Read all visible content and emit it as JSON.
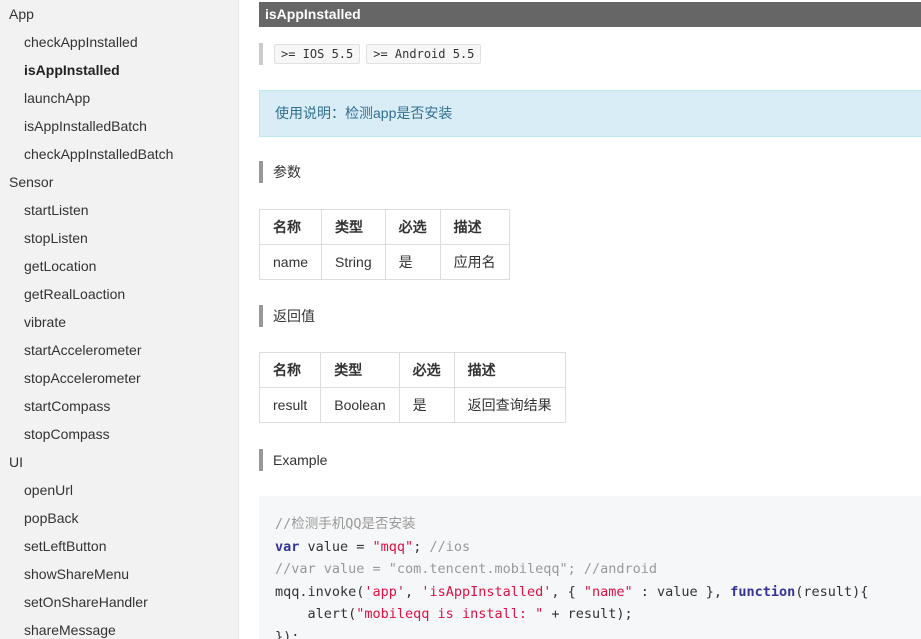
{
  "sidebar": {
    "rows": [
      {
        "type": "group",
        "label": "App"
      },
      {
        "type": "item",
        "label": "checkAppInstalled"
      },
      {
        "type": "item",
        "label": "isAppInstalled",
        "active": true
      },
      {
        "type": "item",
        "label": "launchApp"
      },
      {
        "type": "item",
        "label": "isAppInstalledBatch"
      },
      {
        "type": "item",
        "label": "checkAppInstalledBatch"
      },
      {
        "type": "group",
        "label": "Sensor"
      },
      {
        "type": "item",
        "label": "startListen"
      },
      {
        "type": "item",
        "label": "stopListen"
      },
      {
        "type": "item",
        "label": "getLocation"
      },
      {
        "type": "item",
        "label": "getRealLoaction"
      },
      {
        "type": "item",
        "label": "vibrate"
      },
      {
        "type": "item",
        "label": "startAccelerometer"
      },
      {
        "type": "item",
        "label": "stopAccelerometer"
      },
      {
        "type": "item",
        "label": "startCompass"
      },
      {
        "type": "item",
        "label": "stopCompass"
      },
      {
        "type": "group",
        "label": "UI"
      },
      {
        "type": "item",
        "label": "openUrl"
      },
      {
        "type": "item",
        "label": "popBack"
      },
      {
        "type": "item",
        "label": "setLeftButton"
      },
      {
        "type": "item",
        "label": "showShareMenu"
      },
      {
        "type": "item",
        "label": "setOnShareHandler"
      },
      {
        "type": "item",
        "label": "shareMessage"
      }
    ]
  },
  "main": {
    "title": "isAppInstalled",
    "versions": [
      ">= IOS 5.5",
      ">= Android 5.5"
    ],
    "usage": "使用说明：检测app是否安装",
    "params_heading": "参数",
    "params_table": {
      "headers": [
        "名称",
        "类型",
        "必选",
        "描述"
      ],
      "rows": [
        [
          "name",
          "String",
          "是",
          "应用名"
        ]
      ]
    },
    "return_heading": "返回值",
    "return_table": {
      "headers": [
        "名称",
        "类型",
        "必选",
        "描述"
      ],
      "rows": [
        [
          "result",
          "Boolean",
          "是",
          "返回查询结果"
        ]
      ]
    },
    "example_heading": "Example",
    "code_lines": [
      [
        {
          "t": "//检测手机QQ是否安装",
          "c": "cmt"
        }
      ],
      [
        {
          "t": "var",
          "c": "kw"
        },
        {
          "t": " value = ",
          "c": "plain"
        },
        {
          "t": "\"mqq\"",
          "c": "str"
        },
        {
          "t": "; ",
          "c": "plain"
        },
        {
          "t": "//ios",
          "c": "cmt"
        }
      ],
      [
        {
          "t": "//var value = \"com.tencent.mobileqq\"; //android",
          "c": "cmt"
        }
      ],
      [
        {
          "t": "mqq.invoke(",
          "c": "plain"
        },
        {
          "t": "'app'",
          "c": "str"
        },
        {
          "t": ", ",
          "c": "plain"
        },
        {
          "t": "'isAppInstalled'",
          "c": "str"
        },
        {
          "t": ", { ",
          "c": "plain"
        },
        {
          "t": "\"name\"",
          "c": "str"
        },
        {
          "t": " : value }, ",
          "c": "plain"
        },
        {
          "t": "function",
          "c": "kw"
        },
        {
          "t": "(result){",
          "c": "plain"
        }
      ],
      [
        {
          "t": "    alert(",
          "c": "plain"
        },
        {
          "t": "\"mobileqq is install: \"",
          "c": "str"
        },
        {
          "t": " + result);",
          "c": "plain"
        }
      ],
      [
        {
          "t": "});",
          "c": "plain"
        }
      ]
    ]
  }
}
